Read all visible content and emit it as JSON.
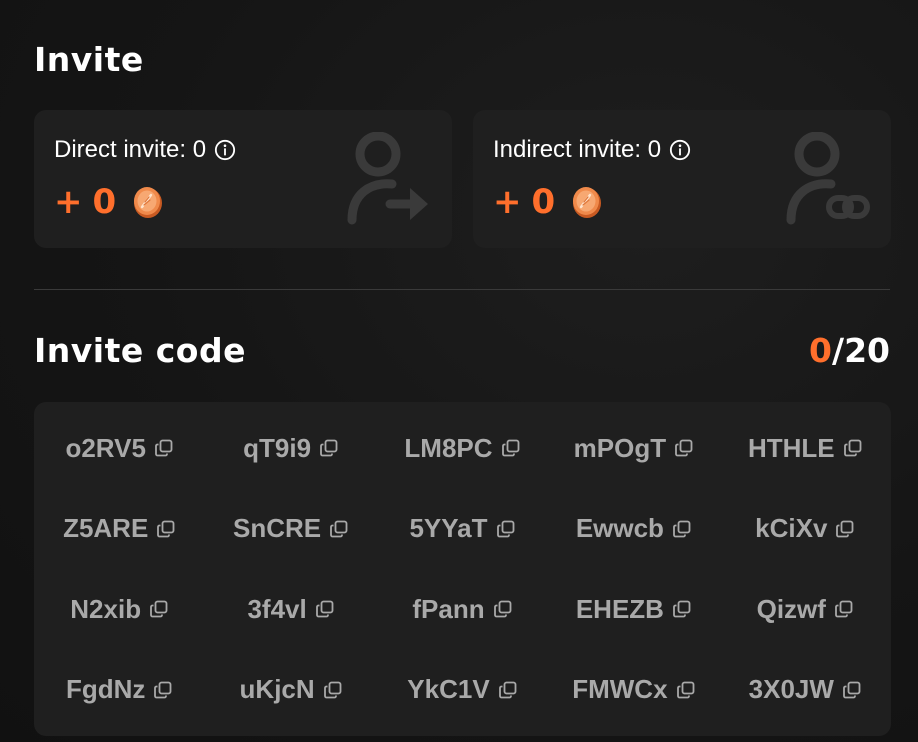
{
  "invite": {
    "title": "Invite",
    "direct": {
      "label": "Direct invite: 0",
      "reward": "0",
      "plus": "+"
    },
    "indirect": {
      "label": "Indirect invite: 0",
      "reward": "0",
      "plus": "+"
    }
  },
  "codes": {
    "title": "Invite code",
    "used": "0",
    "separator": "/",
    "total": "20",
    "list": [
      "o2RV5",
      "qT9i9",
      "LM8PC",
      "mPOgT",
      "HTHLE",
      "Z5ARE",
      "SnCRE",
      "5YYaT",
      "Ewwcb",
      "kCiXv",
      "N2xib",
      "3f4vl",
      "fPann",
      "EHEZB",
      "Qizwf",
      "FgdNz",
      "uKjcN",
      "YkC1V",
      "FMWCx",
      "3X0JW"
    ]
  },
  "icons": {
    "info": "info-icon",
    "coin": "coin-icon",
    "direct_bg": "user-arrow-icon",
    "indirect_bg": "user-link-icon",
    "copy": "copy-icon"
  },
  "colors": {
    "accent": "#ff6f2c",
    "card": "#1f1f1f",
    "code_text": "#a9a9a9"
  }
}
